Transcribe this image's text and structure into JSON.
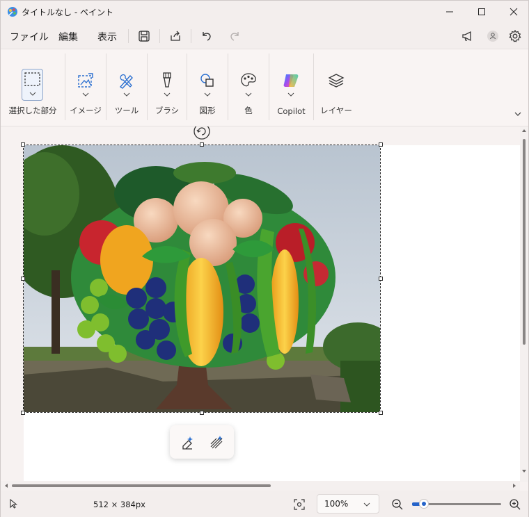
{
  "window": {
    "title": "タイトルなし - ペイント"
  },
  "menubar": {
    "file": "ファイル",
    "edit": "編集",
    "view": "表示",
    "icons": [
      "save-icon",
      "share-icon",
      "undo-icon",
      "redo-icon",
      "announcements-icon",
      "account-icon",
      "settings-icon"
    ]
  },
  "ribbon": {
    "groups": [
      {
        "label": "選択した部分",
        "icon": "selection-icon"
      },
      {
        "label": "イメージ",
        "icon": "image-icon"
      },
      {
        "label": "ツール",
        "icon": "tools-icon"
      },
      {
        "label": "ブラシ",
        "icon": "brush-icon"
      },
      {
        "label": "図形",
        "icon": "shapes-icon"
      },
      {
        "label": "色",
        "icon": "palette-icon"
      },
      {
        "label": "Copilot",
        "icon": "copilot-icon"
      },
      {
        "label": "レイヤー",
        "icon": "layers-icon"
      }
    ]
  },
  "canvas": {
    "image_description_icon": "fruit-tree-photo",
    "floating_toolbar": [
      "remove-background-icon",
      "erase-region-icon"
    ]
  },
  "status": {
    "image_size": "512 × 384px",
    "zoom": "100%",
    "zoom_level": 0.13
  },
  "colors": {
    "accent": "#2563c9",
    "window_bg": "#f7f2f1",
    "paper": "#ffffff"
  }
}
